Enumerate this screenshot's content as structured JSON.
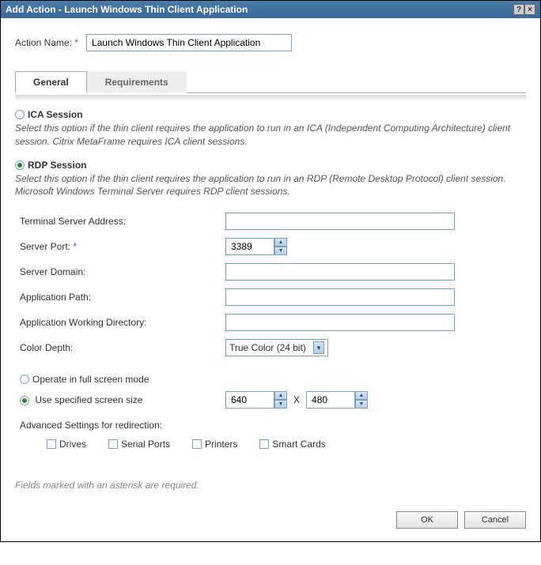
{
  "titlebar": {
    "title": "Add Action - Launch Windows Thin Client Application"
  },
  "actionName": {
    "label": "Action Name:",
    "value": "Launch Windows Thin Client Application"
  },
  "tabs": {
    "general": "General",
    "requirements": "Requirements"
  },
  "ica": {
    "label": "ICA Session",
    "desc": "Select this option if the thin client requires the application to run in an ICA (Independent Computing Architecture) client session. Citrix MetaFrame requires ICA client sessions."
  },
  "rdp": {
    "label": "RDP Session",
    "desc": "Select this option if the thin client requires the application to run in an RDP (Remote Desktop Protocol) client session. Microsoft Windows Terminal Server requires RDP client sessions."
  },
  "fields": {
    "terminalServer": "Terminal Server Address:",
    "serverPort": "Server Port:",
    "serverPortValue": "3389",
    "serverDomain": "Server Domain:",
    "appPath": "Application Path:",
    "appWorkDir": "Application Working Directory:",
    "colorDepth": "Color Depth:",
    "colorDepthValue": "True Color (24 bit)"
  },
  "screen": {
    "fullscreen": "Operate in full screen mode",
    "specified": "Use specified screen size",
    "width": "640",
    "height": "480",
    "x": "X"
  },
  "advanced": {
    "label": "Advanced Settings for redirection:",
    "drives": "Drives",
    "serialPorts": "Serial Ports",
    "printers": "Printers",
    "smartCards": "Smart Cards"
  },
  "footerNote": "Fields marked with an asterisk are required.",
  "buttons": {
    "ok": "OK",
    "cancel": "Cancel"
  },
  "asterisk": "*"
}
